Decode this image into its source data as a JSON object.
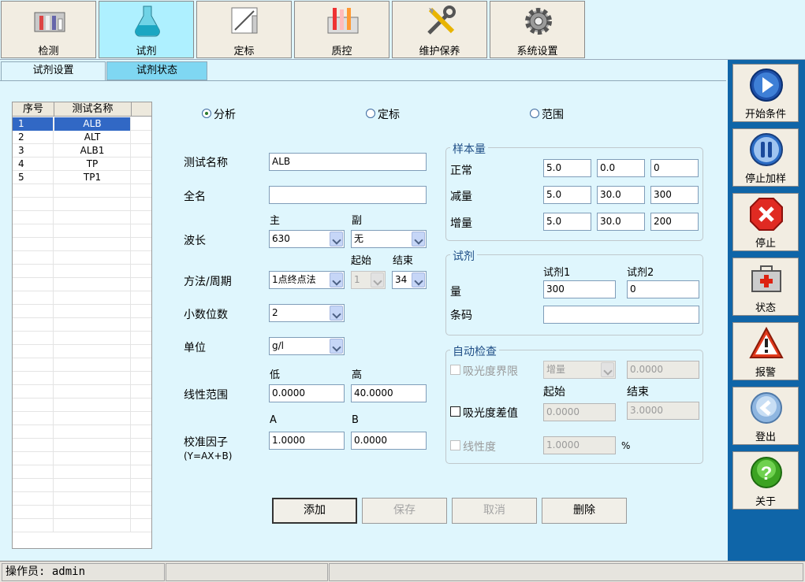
{
  "top_tabs": [
    {
      "label": "检测",
      "icon": "test-tubes-icon"
    },
    {
      "label": "试剂",
      "icon": "flask-icon"
    },
    {
      "label": "定标",
      "icon": "calibration-chart-icon"
    },
    {
      "label": "质控",
      "icon": "qc-rack-icon"
    },
    {
      "label": "维护保养",
      "icon": "tools-icon"
    },
    {
      "label": "系统设置",
      "icon": "gear-icon"
    }
  ],
  "sub_tabs": [
    "试剂设置",
    "试剂状态"
  ],
  "test_list": {
    "headers": [
      "序号",
      "测试名称"
    ],
    "rows": [
      {
        "no": "1",
        "name": "ALB"
      },
      {
        "no": "2",
        "name": "ALT"
      },
      {
        "no": "3",
        "name": "ALB1"
      },
      {
        "no": "4",
        "name": "TP"
      },
      {
        "no": "5",
        "name": "TP1"
      }
    ]
  },
  "mode_radios": [
    "分析",
    "定标",
    "范围"
  ],
  "form": {
    "test_name_label": "测试名称",
    "test_name_value": "ALB",
    "full_name_label": "全名",
    "full_name_value": "",
    "main_label": "主",
    "sub_label": "副",
    "wavelength_label": "波长",
    "wavelength_main": "630",
    "wavelength_sub": "无",
    "start_label": "起始",
    "end_label": "结束",
    "method_label": "方法/周期",
    "method_value": "1点终点法",
    "method_start": "1",
    "method_end": "34",
    "decimals_label": "小数位数",
    "decimals_value": "2",
    "unit_label": "单位",
    "unit_value": "g/l",
    "low_label": "低",
    "high_label": "高",
    "linear_label": "线性范围",
    "linear_low": "0.0000",
    "linear_high": "40.0000",
    "a_label": "A",
    "b_label": "B",
    "factor_label": "校准因子",
    "factor_formula": "(Y=AX+B)",
    "factor_a": "1.0000",
    "factor_b": "0.0000"
  },
  "sample": {
    "title": "样本量",
    "rows": [
      {
        "label": "正常",
        "v1": "5.0",
        "v2": "0.0",
        "v3": "0"
      },
      {
        "label": "减量",
        "v1": "5.0",
        "v2": "30.0",
        "v3": "300"
      },
      {
        "label": "增量",
        "v1": "5.0",
        "v2": "30.0",
        "v3": "200"
      }
    ]
  },
  "reagent": {
    "title": "试剂",
    "r1_label": "试剂1",
    "r2_label": "试剂2",
    "qty_label": "量",
    "r1_value": "300",
    "r2_value": "0",
    "barcode_label": "条码",
    "barcode_value": ""
  },
  "auto": {
    "title": "自动检查",
    "abs_limit_label": "吸光度界限",
    "abs_limit_select": "增量",
    "abs_limit_value": "0.0000",
    "start_label": "起始",
    "end_label": "结束",
    "abs_diff_label": "吸光度差值",
    "abs_diff_start": "0.0000",
    "abs_diff_end": "3.0000",
    "linearity_label": "线性度",
    "linearity_value": "1.0000",
    "percent": "%"
  },
  "actions": {
    "add": "添加",
    "save": "保存",
    "cancel": "取消",
    "delete": "删除"
  },
  "side_buttons": [
    {
      "label": "开始条件",
      "icon": "play-icon"
    },
    {
      "label": "停止加样",
      "icon": "pause-icon"
    },
    {
      "label": "停止",
      "icon": "stop-x-icon"
    },
    {
      "label": "状态",
      "icon": "first-aid-kit-icon"
    },
    {
      "label": "报警",
      "icon": "warning-icon"
    },
    {
      "label": "登出",
      "icon": "logout-icon"
    },
    {
      "label": "关于",
      "icon": "help-icon"
    }
  ],
  "status_bar": {
    "operator": "操作员: admin"
  },
  "colors": {
    "background": "#dff6fd",
    "active_tab": "#aef0ff",
    "side_panel": "#0f65a8",
    "selection": "#3168c5"
  }
}
